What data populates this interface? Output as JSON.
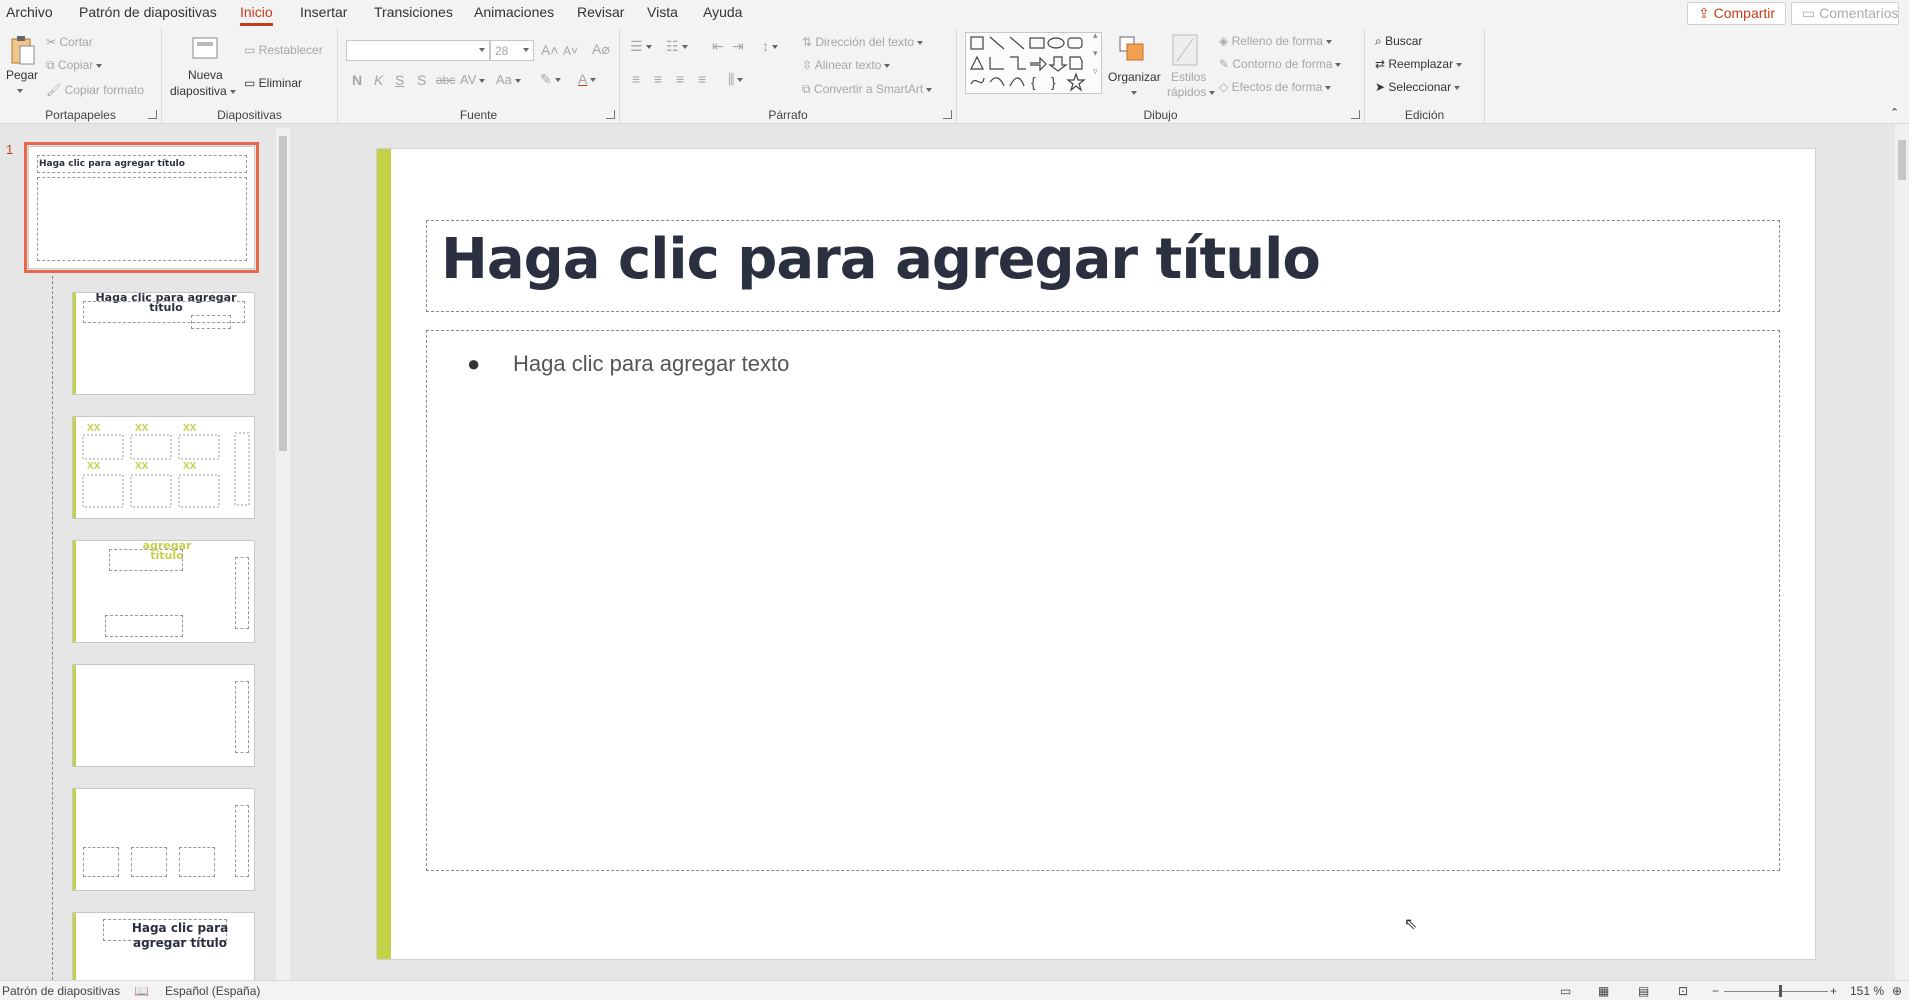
{
  "tabs": [
    "Archivo",
    "Patrón de diapositivas",
    "Inicio",
    "Insertar",
    "Transiciones",
    "Animaciones",
    "Revisar",
    "Vista",
    "Ayuda"
  ],
  "active_tab": "Inicio",
  "share_label": "Compartir",
  "comments_label": "Comentarios",
  "ribbon": {
    "clipboard": {
      "paste": "Pegar",
      "cut": "Cortar",
      "copy": "Copiar",
      "format": "Copiar formato",
      "label": "Portapapeles"
    },
    "slides": {
      "new_line1": "Nueva",
      "new_line2": "diapositiva",
      "reset": "Restablecer",
      "delete": "Eliminar",
      "label": "Diapositivas"
    },
    "font": {
      "size": "28",
      "bold": "N",
      "italic": "K",
      "underline": "S",
      "shadow": "S",
      "strike": "abc",
      "spacing": "AV",
      "case": "Aa",
      "label": "Fuente"
    },
    "paragraph": {
      "direction": "Dirección del texto",
      "align": "Alinear texto",
      "smartart": "Convertir a SmartArt",
      "label": "Párrafo"
    },
    "drawing": {
      "arrange": "Organizar",
      "styles_line1": "Estilos",
      "styles_line2": "rápidos",
      "fill": "Relleno de forma",
      "outline": "Contorno de forma",
      "effects": "Efectos de forma",
      "label": "Dibujo"
    },
    "editing": {
      "find": "Buscar",
      "replace": "Reemplazar",
      "select": "Seleccionar",
      "label": "Edición"
    }
  },
  "thumbnails": {
    "slide_number": "1",
    "t1_title": "Haga clic para agregar título",
    "t2_title": "Haga clic para agregar título",
    "t4_title": "agregar título",
    "t7_title": "Haga clic para agregar título"
  },
  "slide": {
    "title": "Haga clic para agregar título",
    "bullet": "●",
    "body": "Haga clic para agregar texto"
  },
  "status": {
    "view": "Patrón de diapositivas",
    "language": "Español (España)",
    "zoom": "151 %"
  },
  "colors": {
    "accent": "#c4d047",
    "brand": "#c43e1c",
    "title_text": "#2b3040"
  }
}
